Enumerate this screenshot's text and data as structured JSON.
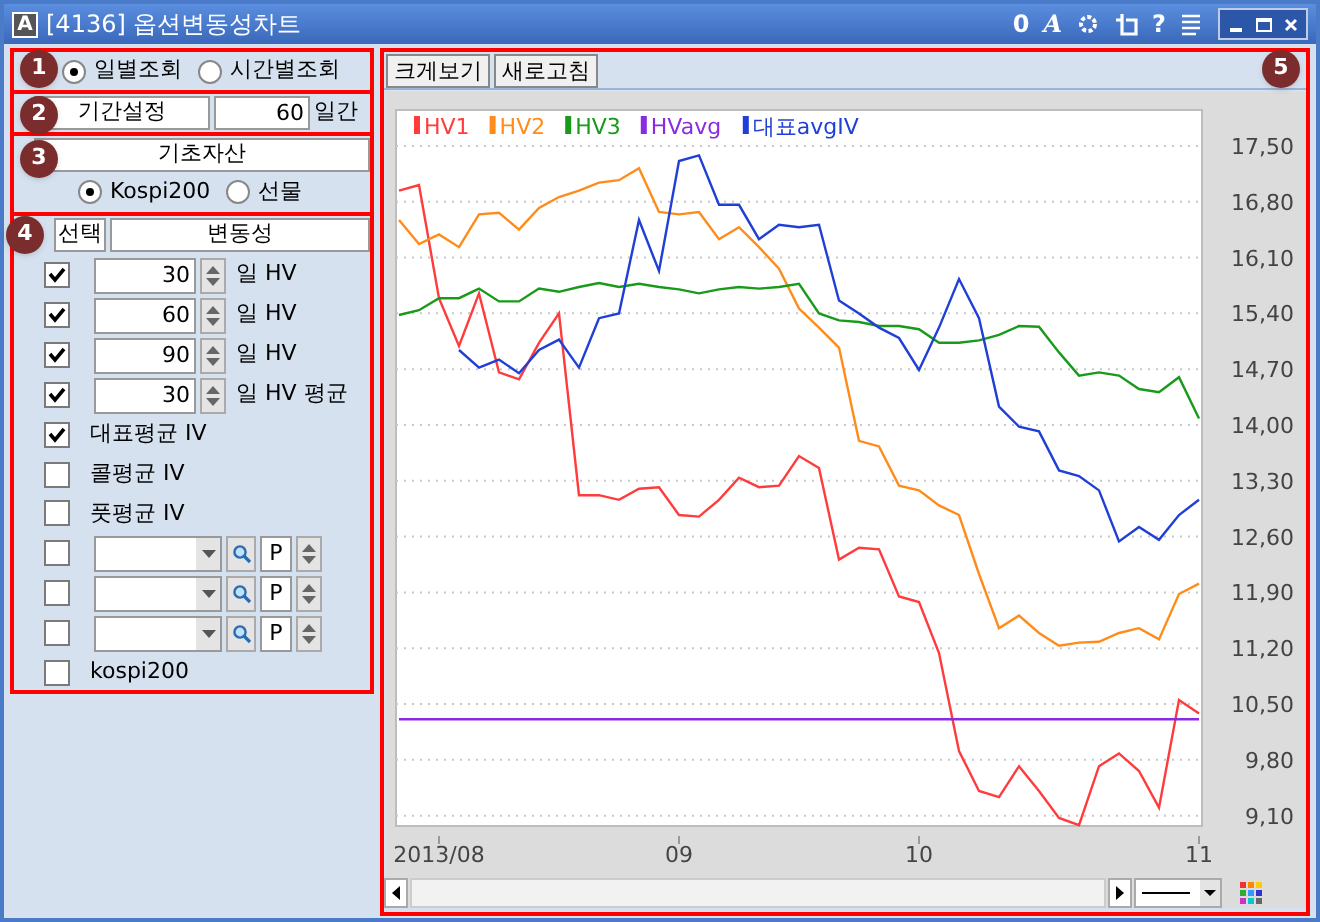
{
  "title_bar": {
    "code": "A",
    "title": "[4136] 옵션변동성차트",
    "buttons": [
      "0",
      "A",
      "?"
    ]
  },
  "markers": [
    "1",
    "2",
    "3",
    "4",
    "5"
  ],
  "query_mode": [
    {
      "label": "일별조회",
      "selected": true
    },
    {
      "label": "시간별조회",
      "selected": false
    }
  ],
  "period": {
    "label": "기간설정",
    "value": "60",
    "unit": "일간"
  },
  "underlying": {
    "label": "기초자산",
    "options": [
      {
        "label": "Kospi200",
        "selected": true
      },
      {
        "label": "선물",
        "selected": false
      }
    ]
  },
  "variables": {
    "header": [
      "선택",
      "변동성"
    ],
    "rows": [
      {
        "kind": "spin",
        "checked": true,
        "value": "30",
        "label": "일 HV"
      },
      {
        "kind": "spin",
        "checked": true,
        "value": "60",
        "label": "일 HV"
      },
      {
        "kind": "spin",
        "checked": true,
        "value": "90",
        "label": "일 HV"
      },
      {
        "kind": "spin",
        "checked": true,
        "value": "30",
        "label": "일 HV 평균"
      },
      {
        "kind": "check",
        "checked": true,
        "label": "대표평균 IV"
      },
      {
        "kind": "check",
        "checked": false,
        "label": "콜평균 IV"
      },
      {
        "kind": "check",
        "checked": false,
        "label": "풋평균 IV"
      },
      {
        "kind": "combo",
        "checked": false,
        "button": "P"
      },
      {
        "kind": "combo",
        "checked": false,
        "button": "P"
      },
      {
        "kind": "combo",
        "checked": false,
        "button": "P"
      },
      {
        "kind": "check",
        "checked": false,
        "label": "kospi200"
      }
    ]
  },
  "toolbar": [
    "크게보기",
    "새로고침"
  ],
  "chart_data": {
    "type": "line",
    "categories": [
      null,
      null,
      "2013/08",
      null,
      null,
      null,
      null,
      null,
      null,
      null,
      null,
      null,
      null,
      null,
      "09",
      null,
      null,
      null,
      null,
      null,
      null,
      null,
      null,
      null,
      null,
      null,
      "10",
      null,
      null,
      null,
      null,
      null,
      null,
      null,
      null,
      null,
      null,
      null,
      null,
      null,
      "11"
    ],
    "ylim": [
      8.97,
      17.95
    ],
    "grid": true,
    "legend": true,
    "yticks": [
      {
        "value": 9.1,
        "label": "9,10"
      },
      {
        "value": 9.8,
        "label": "9,80"
      },
      {
        "value": 10.5,
        "label": "10,50"
      },
      {
        "value": 11.2,
        "label": "11,20"
      },
      {
        "value": 11.9,
        "label": "11,90"
      },
      {
        "value": 12.6,
        "label": "12,60"
      },
      {
        "value": 13.3,
        "label": "13,30"
      },
      {
        "value": 14.0,
        "label": "14,00"
      },
      {
        "value": 14.7,
        "label": "14,70"
      },
      {
        "value": 15.4,
        "label": "15,40"
      },
      {
        "value": 16.1,
        "label": "16,10"
      },
      {
        "value": 16.8,
        "label": "16,80"
      },
      {
        "value": 17.5,
        "label": "17,50"
      }
    ],
    "series": [
      {
        "name": "HV1",
        "color": "#ff3b3b",
        "values": [
          16.94,
          17.01,
          15.59,
          14.99,
          15.65,
          14.66,
          14.57,
          15.03,
          15.4,
          13.12,
          13.12,
          13.06,
          13.2,
          13.22,
          12.87,
          12.85,
          13.06,
          13.34,
          13.22,
          13.24,
          13.61,
          13.46,
          12.31,
          12.46,
          12.44,
          11.85,
          11.78,
          11.14,
          9.91,
          9.41,
          9.33,
          9.72,
          9.41,
          9.07,
          8.98,
          9.72,
          9.88,
          9.66,
          9.2,
          10.55,
          10.38
        ]
      },
      {
        "name": "HV2",
        "color": "#ff8c1a",
        "values": [
          16.57,
          16.27,
          16.39,
          16.23,
          16.64,
          16.66,
          16.45,
          16.72,
          16.86,
          16.94,
          17.04,
          17.07,
          17.22,
          16.67,
          16.64,
          16.67,
          16.33,
          16.48,
          16.23,
          15.96,
          15.46,
          15.22,
          14.97,
          13.8,
          13.73,
          13.24,
          13.18,
          12.99,
          12.87,
          12.13,
          11.45,
          11.61,
          11.39,
          11.23,
          11.27,
          11.28,
          11.39,
          11.45,
          11.31,
          11.88,
          12.01
        ]
      },
      {
        "name": "HV3",
        "color": "#1a9a1a",
        "values": [
          15.38,
          15.44,
          15.59,
          15.59,
          15.71,
          15.55,
          15.55,
          15.71,
          15.67,
          15.73,
          15.78,
          15.73,
          15.77,
          15.73,
          15.7,
          15.65,
          15.7,
          15.73,
          15.71,
          15.73,
          15.77,
          15.4,
          15.31,
          15.29,
          15.24,
          15.24,
          15.2,
          15.03,
          15.03,
          15.06,
          15.13,
          15.24,
          15.23,
          14.91,
          14.62,
          14.66,
          14.62,
          14.45,
          14.41,
          14.6,
          14.08
        ]
      },
      {
        "name": "HVavg",
        "color": "#8a2be2",
        "values": [
          10.31,
          10.31,
          10.31,
          10.31,
          10.31,
          10.31,
          10.31,
          10.31,
          10.31,
          10.31,
          10.31,
          10.31,
          10.31,
          10.31,
          10.31,
          10.31,
          10.31,
          10.31,
          10.31,
          10.31,
          10.31,
          10.31,
          10.31,
          10.31,
          10.31,
          10.31,
          10.31,
          10.31,
          10.31,
          10.31,
          10.31,
          10.31,
          10.31,
          10.31,
          10.31,
          10.31,
          10.31,
          10.31,
          10.31,
          10.31,
          10.31
        ]
      },
      {
        "name": "대표avgIV",
        "color": "#1f3fd6",
        "values": [
          null,
          null,
          null,
          14.94,
          14.72,
          14.82,
          14.65,
          14.94,
          15.07,
          14.72,
          15.34,
          15.4,
          16.57,
          15.93,
          17.31,
          17.38,
          16.76,
          16.76,
          16.33,
          16.51,
          16.48,
          16.51,
          15.56,
          15.4,
          15.22,
          15.09,
          14.69,
          15.22,
          15.83,
          15.34,
          14.23,
          13.98,
          13.92,
          13.43,
          13.36,
          13.18,
          12.54,
          12.72,
          12.56,
          12.87,
          13.06
        ]
      }
    ]
  }
}
